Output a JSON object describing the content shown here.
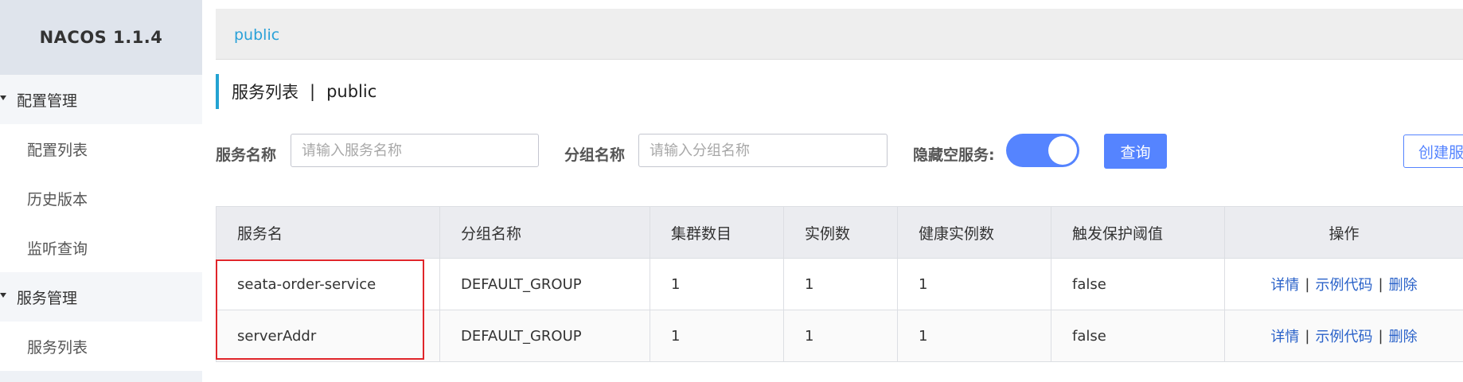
{
  "sidebar": {
    "brand": "NACOS 1.1.4",
    "groups": [
      {
        "label": "配置管理",
        "items": [
          "配置列表",
          "历史版本",
          "监听查询"
        ]
      },
      {
        "label": "服务管理",
        "items": [
          "服务列表"
        ]
      }
    ]
  },
  "namespace": {
    "current": "public"
  },
  "page_title": {
    "text": "服务列表",
    "separator": "|",
    "namespace": "public"
  },
  "filters": {
    "service_name_label": "服务名称",
    "service_name_placeholder": "请输入服务名称",
    "group_name_label": "分组名称",
    "group_name_placeholder": "请输入分组名称",
    "hide_empty_label": "隐藏空服务:",
    "hide_empty_enabled": true,
    "query_button": "查询",
    "create_button": "创建服务"
  },
  "table": {
    "columns": [
      "服务名",
      "分组名称",
      "集群数目",
      "实例数",
      "健康实例数",
      "触发保护阈值",
      "操作"
    ],
    "rows": [
      {
        "name": "seata-order-service",
        "group": "DEFAULT_GROUP",
        "clusters": "1",
        "instances": "1",
        "healthy": "1",
        "threshold": "false"
      },
      {
        "name": "serverAddr",
        "group": "DEFAULT_GROUP",
        "clusters": "1",
        "instances": "1",
        "healthy": "1",
        "threshold": "false"
      }
    ],
    "actions": {
      "detail": "详情",
      "sample_code": "示例代码",
      "delete": "删除",
      "separator": "|"
    }
  },
  "colors": {
    "primary": "#5584ff",
    "accent": "#23a3d2",
    "link": "#2a62c9",
    "highlight": "#e0252a"
  }
}
